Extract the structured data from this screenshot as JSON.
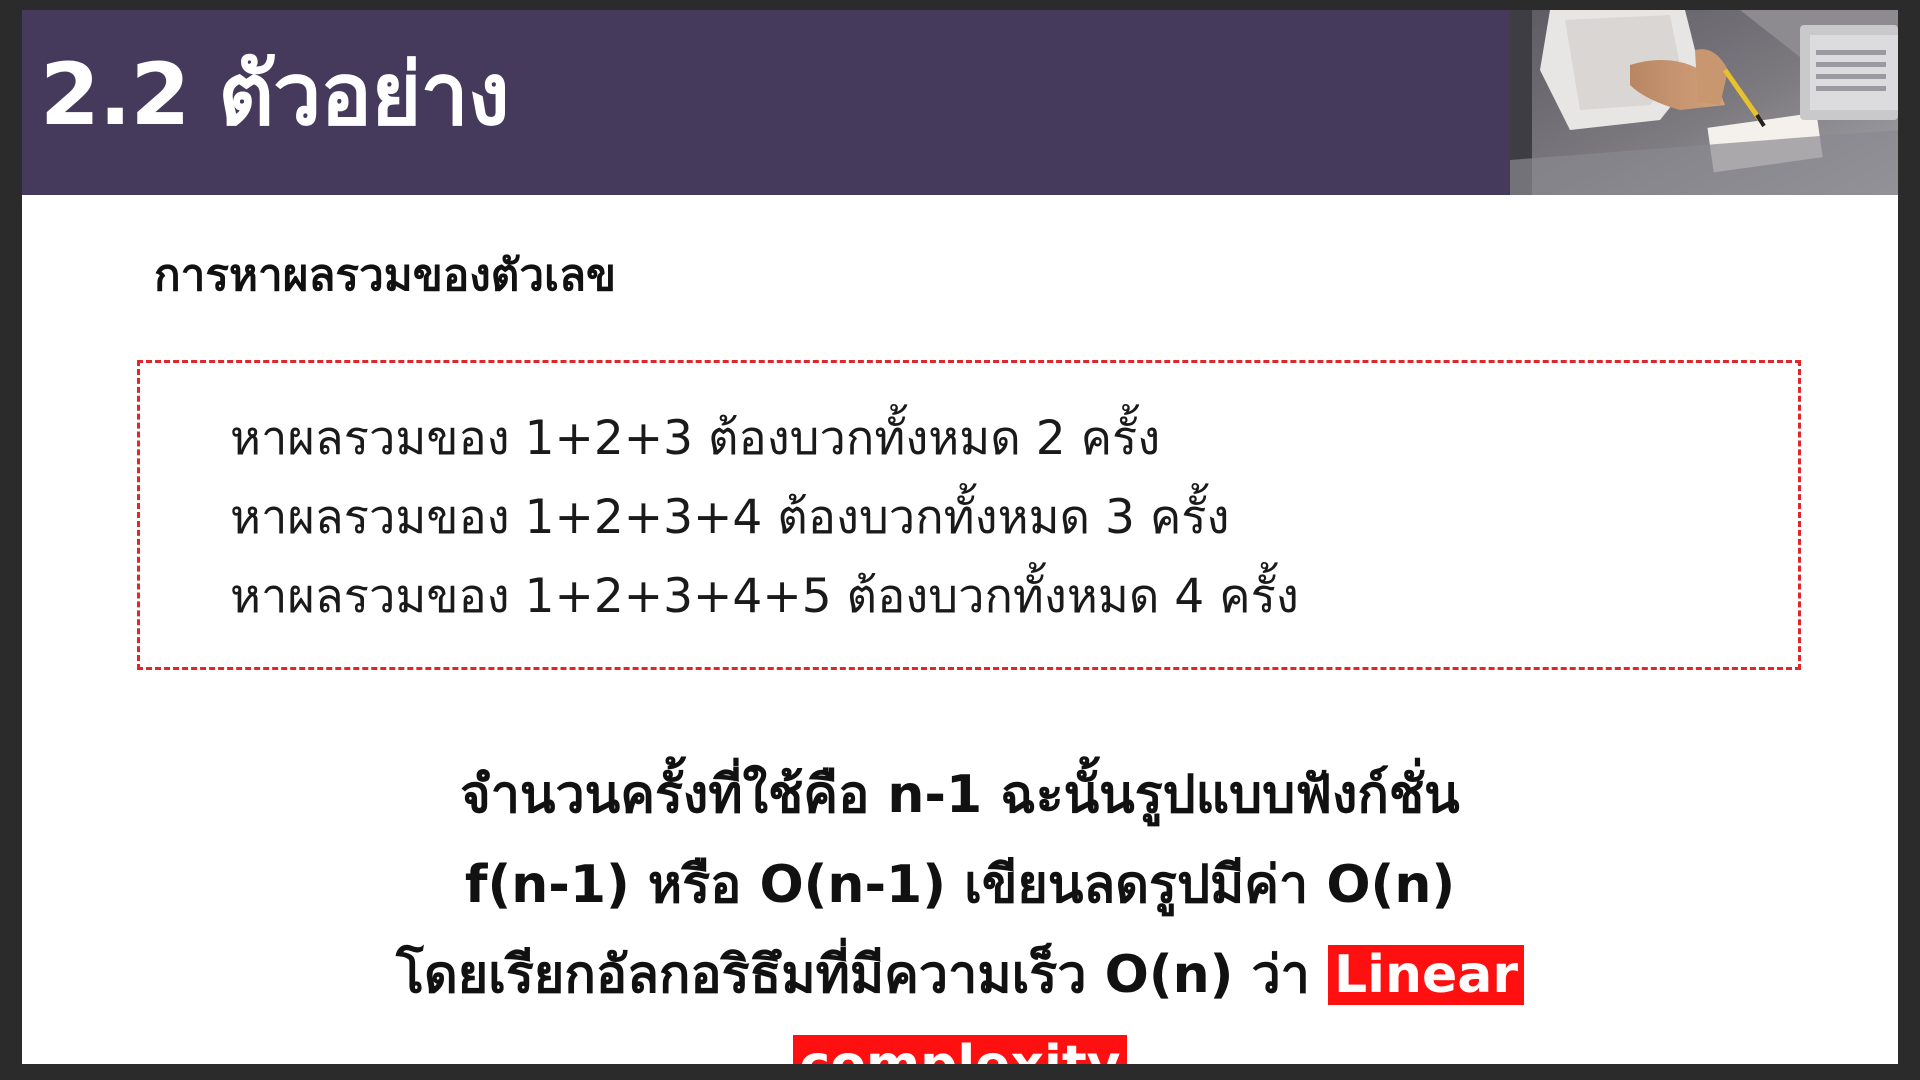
{
  "slide": {
    "title": "2.2 ตัวอย่าง",
    "subtitle": "การหาผลรวมของตัวเลข",
    "examples": [
      "หาผลรวมของ 1+2+3 ต้องบวกทั้งหมด 2 ครั้ง",
      "หาผลรวมของ 1+2+3+4 ต้องบวกทั้งหมด 3 ครั้ง",
      "หาผลรวมของ 1+2+3+4+5 ต้องบวกทั้งหมด 4 ครั้ง"
    ],
    "conclusion": {
      "line1": "จำนวนครั้งที่ใช้คือ n-1 ฉะนั้นรูปแบบฟังก์ชั่น",
      "line2": "f(n-1) หรือ O(n-1) เขียนลดรูปมีค่า O(n)",
      "line3": "โดยเรียกอัลกอริธึมที่มีความเร็ว O(n) ว่า",
      "highlight_part1": "Linear",
      "highlight_part2": "complexity"
    },
    "colors": {
      "header": "#453a5b",
      "box_border": "#e0262b",
      "highlight": "#ff1010"
    },
    "header_image": "person-writing-photo"
  }
}
